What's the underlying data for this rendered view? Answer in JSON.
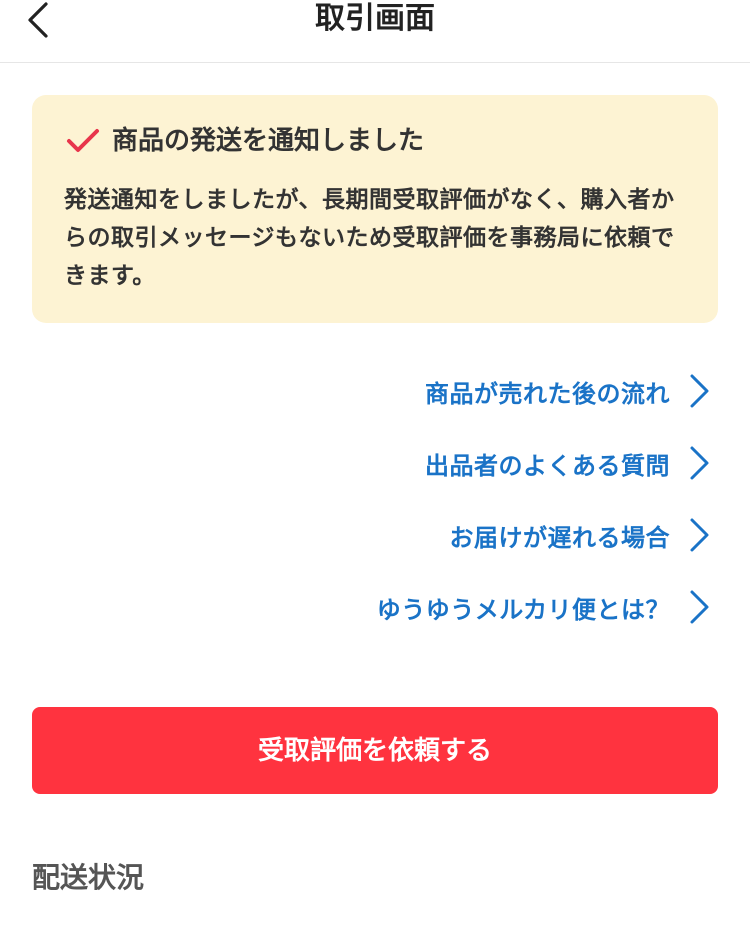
{
  "header": {
    "title": "取引画面",
    "back_icon": "chevron-left-icon"
  },
  "notice": {
    "icon": "check-icon",
    "title": "商品の発送を通知しました",
    "body": "発送通知をしましたが、長期間受取評価がなく、購入者からの取引メッセージもないため受取評価を事務局に依頼できます。",
    "background_color": "#fdf3d3",
    "check_color": "#e8354b"
  },
  "links": [
    {
      "label": "商品が売れた後の流れ"
    },
    {
      "label": "出品者のよくある質問"
    },
    {
      "label": "お届けが遅れる場合"
    },
    {
      "label": "ゆうゆうメルカリ便とは？"
    }
  ],
  "link_color": "#1a73c7",
  "cta": {
    "label": "受取評価を依頼する",
    "color": "#ff333f"
  },
  "section": {
    "title": "配送状況"
  }
}
